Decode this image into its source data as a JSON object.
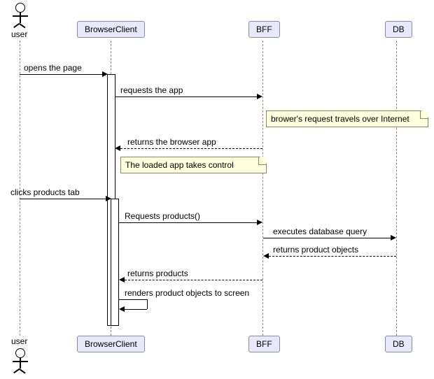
{
  "actors": {
    "user_top": "user",
    "user_bottom": "user"
  },
  "participants": {
    "browserClient_top": "BrowserClient",
    "bff_top": "BFF",
    "db_top": "DB",
    "browserClient_bottom": "BrowserClient",
    "bff_bottom": "BFF",
    "db_bottom": "DB"
  },
  "messages": {
    "m1": "opens the page",
    "m2": "requests the app",
    "m3": "returns the browser app",
    "m4": "clicks products tab",
    "m5": "Requests products()",
    "m6": "executes database query",
    "m7": "returns product objects",
    "m8": "returns products",
    "m9": "renders product objects to screen"
  },
  "notes": {
    "n1": "brower's request travels over Internet",
    "n2": "The loaded app takes control"
  },
  "chart_data": {
    "type": "sequence_diagram",
    "participants": [
      "user",
      "BrowserClient",
      "BFF",
      "DB"
    ],
    "events": [
      {
        "from": "user",
        "to": "BrowserClient",
        "label": "opens the page",
        "kind": "sync"
      },
      {
        "from": "BrowserClient",
        "to": "BFF",
        "label": "requests the app",
        "kind": "sync"
      },
      {
        "note_over": "BFF",
        "text": "brower's request travels over Internet"
      },
      {
        "from": "BFF",
        "to": "BrowserClient",
        "label": "returns the browser app",
        "kind": "return"
      },
      {
        "note_over": "BrowserClient",
        "text": "The loaded app takes control"
      },
      {
        "from": "user",
        "to": "BrowserClient",
        "label": "clicks products tab",
        "kind": "sync"
      },
      {
        "from": "BrowserClient",
        "to": "BFF",
        "label": "Requests products()",
        "kind": "sync"
      },
      {
        "from": "BFF",
        "to": "DB",
        "label": "executes database query",
        "kind": "sync"
      },
      {
        "from": "DB",
        "to": "BFF",
        "label": "returns product objects",
        "kind": "return"
      },
      {
        "from": "BFF",
        "to": "BrowserClient",
        "label": "returns products",
        "kind": "return"
      },
      {
        "from": "BrowserClient",
        "to": "BrowserClient",
        "label": "renders product objects to screen",
        "kind": "self"
      }
    ]
  }
}
